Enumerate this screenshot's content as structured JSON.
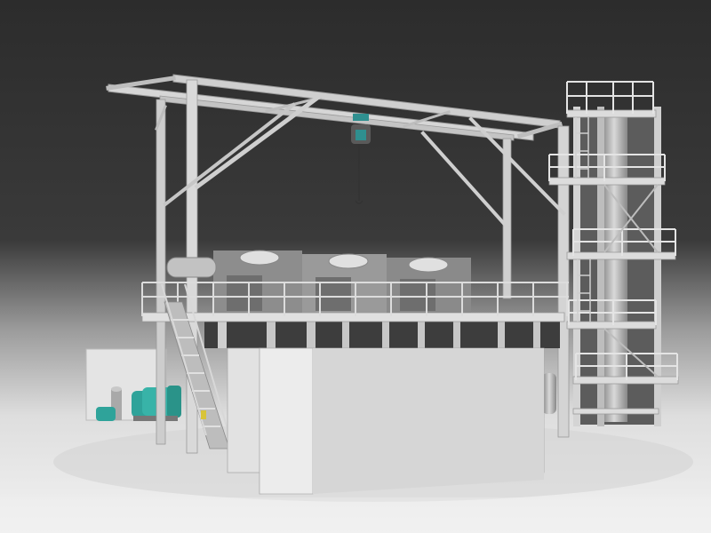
{
  "scene": {
    "colors": {
      "backdrop_top": "#2e2e2e",
      "backdrop_bottom": "#bfbfbf",
      "floor": "#e9e9e9",
      "steel": "#d3d3d3",
      "steel_shadow": "#8e8e8e",
      "enclosure": "#dcdcdc",
      "pump_teal": "#2fa39a",
      "hoist_teal": "#2f8f8f"
    },
    "objects": [
      "overhead-gantry-frame",
      "electric-chain-hoist",
      "raised-equipment-platform",
      "evaporator-units",
      "access-staircase",
      "multi-level-tower",
      "concrete-enclosure-block",
      "side-panel-wall",
      "pump-assembly",
      "filter-vessel"
    ]
  }
}
